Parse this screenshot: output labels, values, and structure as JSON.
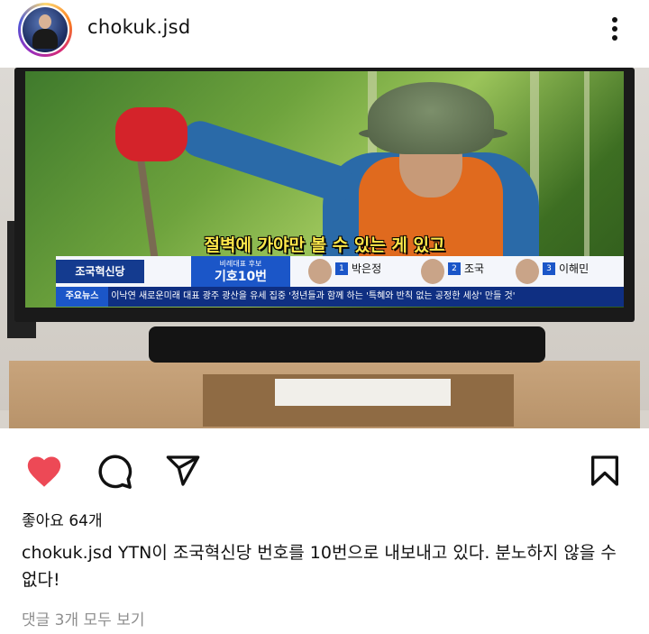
{
  "post": {
    "username": "chokuk.jsd",
    "likes_text": "좋아요 64개",
    "caption_user": "chokuk.jsd",
    "caption_text": "YTN이 조국혁신당 번호를 10번으로 내보내고 있다. 분노하지 않을 수 없다!",
    "comments_link": "댓글 3개 모두 보기"
  },
  "tv_screen": {
    "subtitle": "절벽에 가야만 볼 수 있는 게 있고",
    "banner_logo": "조국혁신당",
    "banner_label_small": "비례대표 후보",
    "banner_label_big": "기호10번",
    "candidates": [
      {
        "no": "1",
        "name": "박은정"
      },
      {
        "no": "2",
        "name": "조국"
      },
      {
        "no": "3",
        "name": "이해민"
      }
    ],
    "ticker_label": "주요뉴스",
    "ticker_text": "이낙연 새로운미래 대표 광주 광산을 유세 집중 '청년들과 함께 하는 '특혜와 반칙 없는 공정한 세상' 만들 것'"
  },
  "colors": {
    "like_red": "#ed4956",
    "banner_blue": "#1b56c8",
    "subtitle_yellow": "#ffe84a"
  },
  "icons": [
    "heart-icon",
    "comment-icon",
    "share-icon",
    "bookmark-icon",
    "more-icon"
  ]
}
